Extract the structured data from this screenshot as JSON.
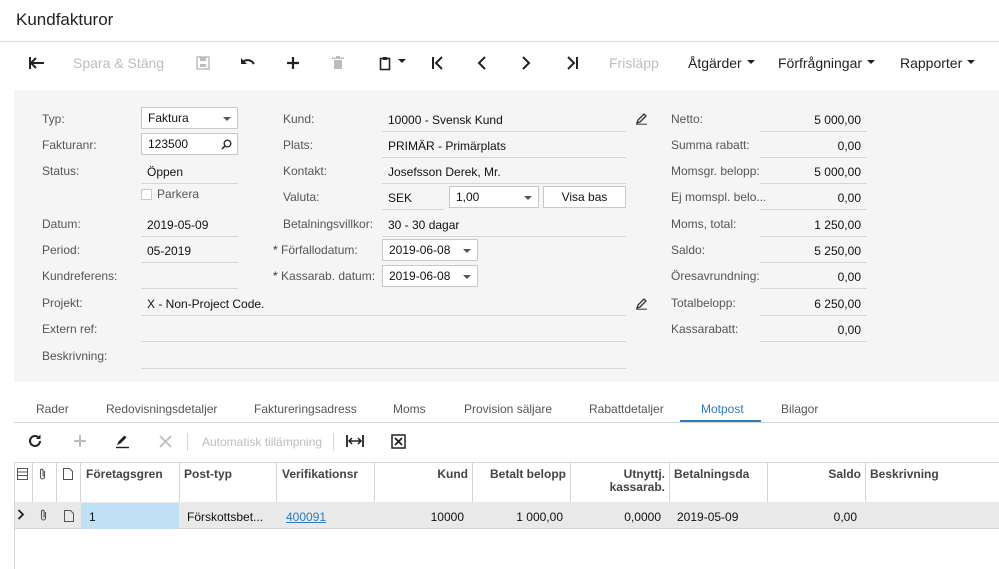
{
  "page": {
    "title": "Kundfakturor"
  },
  "toolbar": {
    "save_close": "Spara & Stäng",
    "release": "Frisläpp",
    "actions": "Åtgärder",
    "inquiries": "Förfrågningar",
    "reports": "Rapporter"
  },
  "form": {
    "type": {
      "label": "Typ:",
      "value": "Faktura"
    },
    "invoice_no": {
      "label": "Fakturanr:",
      "value": "123500"
    },
    "status": {
      "label": "Status:",
      "value": "Öppen"
    },
    "hold": {
      "label": "Parkera",
      "checked": false
    },
    "date": {
      "label": "Datum:",
      "value": "2019-05-09"
    },
    "period": {
      "label": "Period:",
      "value": "05-2019"
    },
    "customer_ref": {
      "label": "Kundreferens:",
      "value": ""
    },
    "project": {
      "label": "Projekt:",
      "value": "X - Non-Project Code."
    },
    "ext_ref": {
      "label": "Extern ref:",
      "value": ""
    },
    "description": {
      "label": "Beskrivning:",
      "value": ""
    },
    "customer": {
      "label": "Kund:",
      "value": "10000 - Svensk Kund"
    },
    "location": {
      "label": "Plats:",
      "value": "PRIMÄR - Primärplats"
    },
    "contact": {
      "label": "Kontakt:",
      "value": "Josefsson Derek, Mr."
    },
    "currency": {
      "label": "Valuta:",
      "code": "SEK",
      "rate": "1,00",
      "view_base": "Visa bas"
    },
    "terms": {
      "label": "Betalningsvillkor:",
      "value": "30 - 30 dagar"
    },
    "due_date": {
      "label": "Förfallodatum:",
      "value": "2019-06-08"
    },
    "cash_disc_date": {
      "label": "Kassarab. datum:",
      "value": "2019-06-08"
    },
    "required_mark": "*"
  },
  "totals": [
    {
      "label": "Netto:",
      "value": "5 000,00"
    },
    {
      "label": "Summa rabatt:",
      "value": "0,00"
    },
    {
      "label": "Momsgr. belopp:",
      "value": "5 000,00"
    },
    {
      "label": "Ej momspl. belo...",
      "value": "0,00"
    },
    {
      "label": "Moms, total:",
      "value": "1 250,00"
    },
    {
      "label": "Saldo:",
      "value": "5 250,00"
    },
    {
      "label": "Öresavrundning:",
      "value": "0,00"
    },
    {
      "label": "Totalbelopp:",
      "value": "6 250,00"
    },
    {
      "label": "Kassarabatt:",
      "value": "0,00"
    }
  ],
  "tabs": [
    "Rader",
    "Redovisningsdetaljer",
    "Faktureringsadress",
    "Moms",
    "Provision säljare",
    "Rabattdetaljer",
    "Motpost",
    "Bilagor"
  ],
  "grid_toolbar": {
    "auto_apply": "Automatisk tillämpning"
  },
  "grid": {
    "columns": [
      "Företagsgren",
      "Post-typ",
      "Verifikationsr",
      "Kund",
      "Betalt belopp",
      "Utnyttj. kassarab.",
      "Betalningsda",
      "Saldo",
      "Beskrivning"
    ],
    "rows": [
      {
        "branch": "1",
        "doc_type": "Förskottsbet...",
        "ref_nbr": "400091",
        "customer": "10000",
        "amount_paid": "1 000,00",
        "cash_disc": "0,0000",
        "payment_date": "2019-05-09",
        "balance": "0,00",
        "description": ""
      }
    ]
  }
}
